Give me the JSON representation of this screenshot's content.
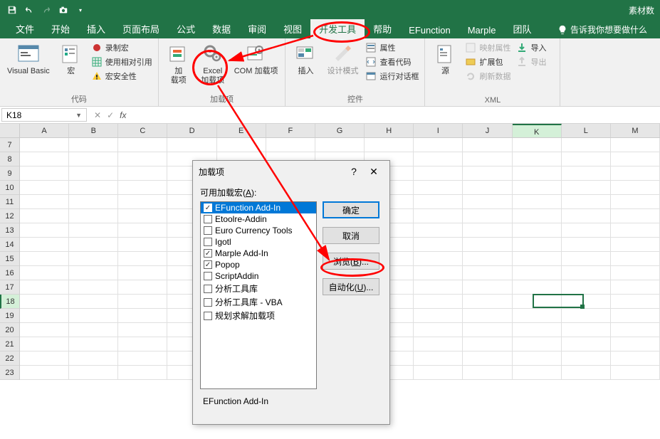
{
  "titlebar": {
    "right_text": "素材数"
  },
  "tabs": {
    "file": "文件",
    "home": "开始",
    "insert": "插入",
    "layout": "页面布局",
    "formulas": "公式",
    "data": "数据",
    "review": "审阅",
    "view": "视图",
    "developer": "开发工具",
    "help": "帮助",
    "efunction": "EFunction",
    "marple": "Marple",
    "team": "团队",
    "tellme": "告诉我你想要做什么"
  },
  "ribbon": {
    "code": {
      "vb": "Visual Basic",
      "macros": "宏",
      "record": "录制宏",
      "relative": "使用相对引用",
      "security": "宏安全性",
      "label": "代码"
    },
    "addins": {
      "addins": "加\n载项",
      "excel_addins": "Excel\n加载项",
      "com_addins": "COM 加载项",
      "label": "加载项"
    },
    "controls": {
      "insert": "插入",
      "design": "设计模式",
      "properties": "属性",
      "viewcode": "查看代码",
      "rundialog": "运行对话框",
      "label": "控件"
    },
    "xml": {
      "source": "源",
      "mapprops": "映射属性",
      "expansion": "扩展包",
      "refresh": "刷新数据",
      "import": "导入",
      "export": "导出",
      "label": "XML"
    }
  },
  "namebox": "K18",
  "columns": [
    "A",
    "B",
    "C",
    "D",
    "E",
    "F",
    "G",
    "H",
    "I",
    "J",
    "K",
    "L",
    "M"
  ],
  "rows_start": 7,
  "rows_end": 23,
  "selected_row": 18,
  "selected_col": "K",
  "dialog": {
    "title": "加载项",
    "help": "?",
    "close": "✕",
    "available_label_pre": "可用加载宏(",
    "available_label_u": "A",
    "available_label_post": "):",
    "items": [
      {
        "label": "EFunction Add-In",
        "checked": true,
        "selected": true
      },
      {
        "label": "Etoolre-Addin",
        "checked": false
      },
      {
        "label": "Euro Currency Tools",
        "checked": false
      },
      {
        "label": "Igotl",
        "checked": false
      },
      {
        "label": "Marple Add-In",
        "checked": true
      },
      {
        "label": "Popop",
        "checked": true
      },
      {
        "label": "ScriptAddin",
        "checked": false
      },
      {
        "label": "分析工具库",
        "checked": false
      },
      {
        "label": "分析工具库 - VBA",
        "checked": false
      },
      {
        "label": "规划求解加载项",
        "checked": false
      }
    ],
    "ok": "确定",
    "cancel": "取消",
    "browse_pre": "浏览(",
    "browse_u": "B",
    "browse_post": ")...",
    "automation_pre": "自动化(",
    "automation_u": "U",
    "automation_post": ")...",
    "description": "EFunction Add-In"
  }
}
